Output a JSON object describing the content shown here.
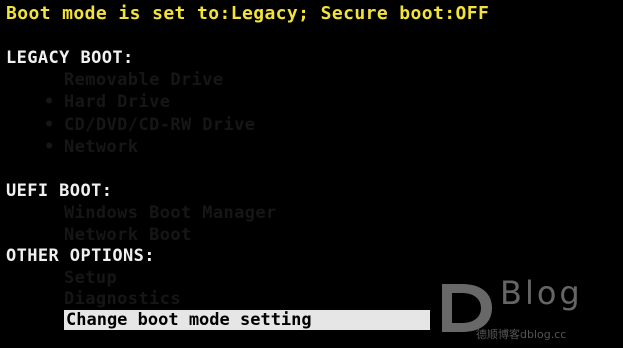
{
  "status_line": "Boot mode is set to:Legacy; Secure boot:OFF",
  "sections": {
    "legacy": {
      "title": "LEGACY BOOT:",
      "items": [
        "Removable Drive",
        "Hard Drive",
        "CD/DVD/CD-RW Drive",
        "Network"
      ]
    },
    "uefi": {
      "title": "UEFI BOOT:",
      "items": [
        "Windows Boot Manager",
        "Network Boot"
      ]
    },
    "other": {
      "title": "OTHER OPTIONS:",
      "items": [
        "Setup",
        "Diagnostics",
        "Change boot mode setting"
      ]
    }
  },
  "watermark": {
    "brand": "Blog",
    "caption": "德顺博客dblog.cc"
  },
  "colors": {
    "background": "#000000",
    "status_text": "#f2e23a",
    "section_text": "#f0f0f0",
    "selection_bg": "#e6e6e6"
  }
}
